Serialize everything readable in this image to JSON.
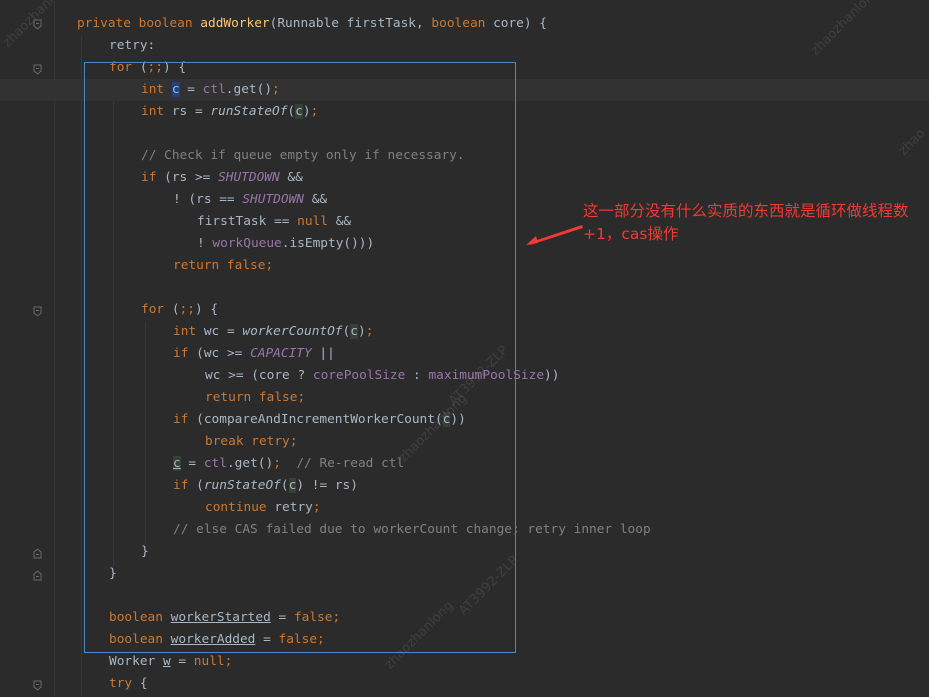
{
  "code": {
    "l1": {
      "a": "private ",
      "b": "boolean ",
      "c": "addWorker",
      "d": "(Runnable firstTask, ",
      "e": "boolean ",
      "f": "core) {"
    },
    "l2": {
      "a": "retry:"
    },
    "l3": {
      "a": "for ",
      "b": "(",
      "c": ";;",
      "d": ") {"
    },
    "l4": {
      "a": "int ",
      "b": "c",
      "c": " = ",
      "d": "ctl",
      "e": ".get()",
      "f": ";"
    },
    "l5": {
      "a": "int ",
      "b": "rs = ",
      "c": "runStateOf",
      "d": "(",
      "e": "c",
      "f": ")",
      "g": ";"
    },
    "l6": {
      "a": "// Check if queue empty only if necessary."
    },
    "l7": {
      "a": "if ",
      "b": "(rs >= ",
      "c": "SHUTDOWN",
      "d": " &&"
    },
    "l8": {
      "a": "! (rs == ",
      "b": "SHUTDOWN",
      "c": " &&"
    },
    "l9": {
      "a": "firstTask == ",
      "b": "null",
      "c": " &&"
    },
    "l10": {
      "a": "! ",
      "b": "workQueue",
      "c": ".isEmpty()))"
    },
    "l11": {
      "a": "return false",
      "b": ";"
    },
    "l12": {
      "a": "for ",
      "b": "(",
      "c": ";;",
      "d": ") {"
    },
    "l13": {
      "a": "int ",
      "b": "wc = ",
      "c": "workerCountOf",
      "d": "(",
      "e": "c",
      "f": ")",
      "g": ";"
    },
    "l14": {
      "a": "if ",
      "b": "(wc >= ",
      "c": "CAPACITY",
      "d": " ||"
    },
    "l15": {
      "a": "wc >= (core ? ",
      "b": "corePoolSize",
      "c": " : ",
      "d": "maximumPoolSize",
      "e": "))"
    },
    "l16": {
      "a": "return false",
      "b": ";"
    },
    "l17": {
      "a": "if ",
      "b": "(compareAndIncrementWorkerCount(",
      "c": "c",
      "d": "))"
    },
    "l18": {
      "a": "break ",
      "b": "retry",
      "c": ";"
    },
    "l19": {
      "a": "c",
      "b": " = ",
      "c": "ctl",
      "d": ".get()",
      "e": ";  ",
      "f": "// Re-read ctl"
    },
    "l20": {
      "a": "if ",
      "b": "(",
      "c": "runStateOf",
      "d": "(",
      "e": "c",
      "f": ") != rs)"
    },
    "l21": {
      "a": "continue ",
      "b": "retry",
      "c": ";"
    },
    "l22": {
      "a": "// else CAS failed due to workerCount change; retry inner loop"
    },
    "l23": {
      "a": "}"
    },
    "l24": {
      "a": "}"
    },
    "l25": {
      "a": "boolean ",
      "b": "workerStarted",
      "c": " = ",
      "d": "false",
      "e": ";"
    },
    "l26": {
      "a": "boolean ",
      "b": "workerAdded",
      "c": " = ",
      "d": "false",
      "e": ";"
    },
    "l27": {
      "a": "Worker ",
      "b": "w",
      "c": " = ",
      "d": "null",
      "e": ";"
    },
    "l28": {
      "a": "try ",
      "b": "{"
    }
  },
  "annotation": {
    "text": "这一部分没有什么实质的东西就是循环做线程数+1，cas操作"
  },
  "watermarks": {
    "w1": "zhaozhanlong",
    "w2": "zhaozhanlong",
    "w3": "AT3992-ZLP",
    "w4": "zhaozhanlong",
    "w5": "AT3992-ZLP",
    "w6": "zhaozhanlong",
    "w7": "zhao"
  },
  "colors": {
    "background": "#2b2b2b",
    "keyword": "#cc7832",
    "method": "#ffc66d",
    "field": "#9876aa",
    "comment": "#808080",
    "text": "#a9b7c6",
    "selection_border": "#4a88c7",
    "annotation": "#f03a33"
  },
  "icons": {
    "fold": "fold-marker-icon",
    "arrow": "annotation-arrow-icon"
  }
}
